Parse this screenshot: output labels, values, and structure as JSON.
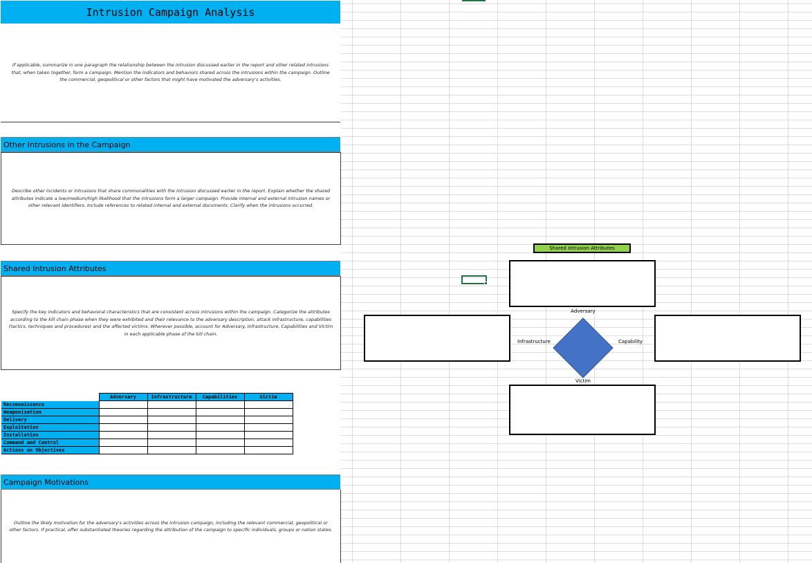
{
  "title": "Intrusion Campaign Analysis",
  "summary_text": "If applicable, summarize in one paragraph the relationship between the intrusion discussed earlier in the report and other related intrusions that, when taken together, form a campaign. Mention the indicators and behaviors shared across the intrusions within the campaign. Outline the commercial, geopolitical or other factors that might have motivated the adversary's activities.",
  "other_intrusions": {
    "heading": "Other Intrusions in the Campaign",
    "text": "Describe other incidents or intrusions that share commonalities with the intrusion discussed earlier in the report. Explain whether the shared attributes indicate a low/medium/high likelihood that the intrusions form a larger campaign. Provide internal and external intrusion names or other relevant identifiers. Include references to related internal and external documents. Clarify when the intrusions occurred."
  },
  "shared_attributes": {
    "heading": "Shared Intrusion Attributes",
    "text": "Specify the key indicators and behavioral characteristics that are consistent across intrusions within the campaign. Categorize the attributes according to the kill chain phase when they were exhibited and their relevance to the adversary description, attack infrastructure, capabilities (tactics, techniques and procedures) and the affected victims. Wherever possible, account for Adversary, Infrastructure, Capabilities and Victim in each applicable phase of the kill chain."
  },
  "kill_chain_table": {
    "columns": [
      "Adversary",
      "Infrastructure",
      "Capabilities",
      "Victim"
    ],
    "phases": [
      "Reconnaissance",
      "Weaponization",
      "Delivery",
      "Exploitation",
      "Installation",
      "Command and Control",
      "Actions on Objectives"
    ]
  },
  "motivations": {
    "heading": "Campaign Motivations",
    "text": "Outline the likely motivation for the adversary's activities across the intrusion campaign, including the relevant commercial, geopolitical or other factors. If practical, offer substantiated theories regarding the attribution of the campaign to specific individuals, groups or nation states."
  },
  "diamond_model": {
    "title": "Shared Intrusion Attributes",
    "title_color": "#92d050",
    "diamond_color": "#4472c4",
    "labels": {
      "adversary": "Adversary",
      "infrastructure": "Infrastructure",
      "capability": "Capability",
      "victim": "Victim"
    }
  },
  "colors": {
    "header_bg": "#00b0f0",
    "grid": "#dcdcdc",
    "selection": "#217346"
  }
}
